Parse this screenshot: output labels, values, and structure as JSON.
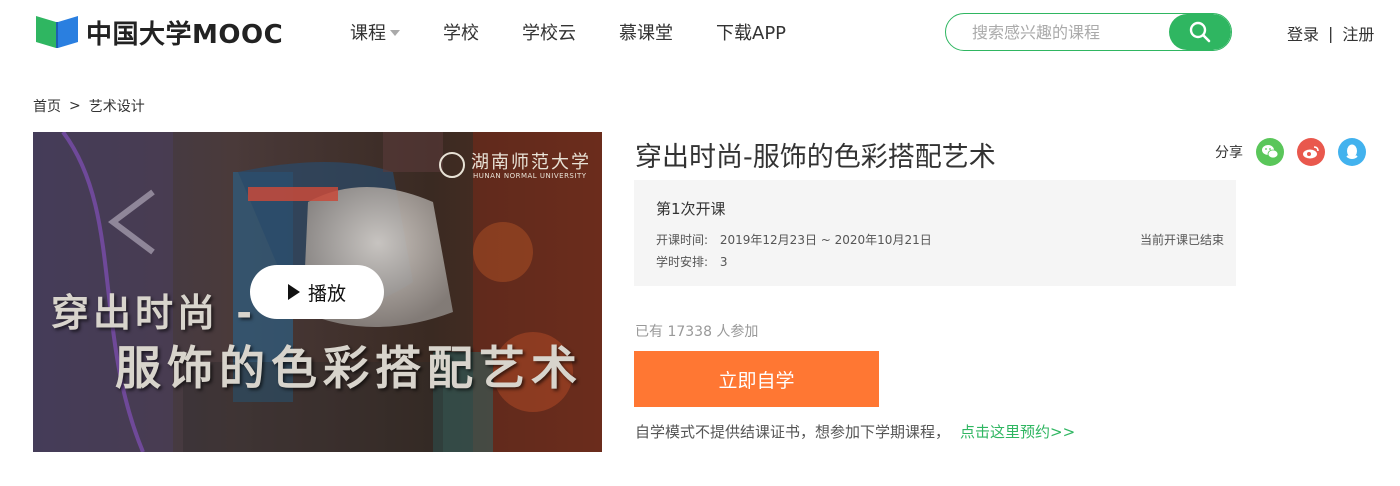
{
  "brand": {
    "name": "中国大学MOOC",
    "logo_icon": "book-logo-icon",
    "color": "#2fb661"
  },
  "nav": {
    "items": [
      {
        "label": "课程",
        "has_dropdown": true
      },
      {
        "label": "学校"
      },
      {
        "label": "学校云"
      },
      {
        "label": "慕课堂"
      },
      {
        "label": "下载APP"
      }
    ]
  },
  "search": {
    "placeholder": "搜索感兴趣的课程",
    "button_icon": "search-icon"
  },
  "auth": {
    "login": "登录",
    "separator": "|",
    "register": "注册"
  },
  "breadcrumb": {
    "home": "首页",
    "separator": ">",
    "current": "艺术设计"
  },
  "cover": {
    "title_line1": "穿出时尚 -",
    "title_line2": "服饰的色彩搭配艺术",
    "seal_text": "湖南师范大学",
    "seal_sub": "HUNAN NORMAL UNIVERSITY",
    "play_label": "播放"
  },
  "course": {
    "title": "穿出时尚-服饰的色彩搭配艺术"
  },
  "share": {
    "label": "分享",
    "icons": [
      {
        "name": "wechat-icon",
        "color": "#5ac65a"
      },
      {
        "name": "weibo-icon",
        "color": "#e9584d"
      },
      {
        "name": "qq-icon",
        "color": "#42b2ee"
      }
    ]
  },
  "term": {
    "name": "第1次开课",
    "time_label": "开课时间:",
    "time_value": "2019年12月23日 ~ 2020年10月21日",
    "schedule_label": "学时安排:",
    "schedule_value": "3",
    "status": "当前开课已结束"
  },
  "enroll": {
    "count_text": "已有 17338 人参加"
  },
  "cta": {
    "label": "立即自学",
    "color": "#ff7733"
  },
  "note": {
    "text": "自学模式不提供结课证书，想参加下学期课程，",
    "link": "点击这里预约>>"
  }
}
